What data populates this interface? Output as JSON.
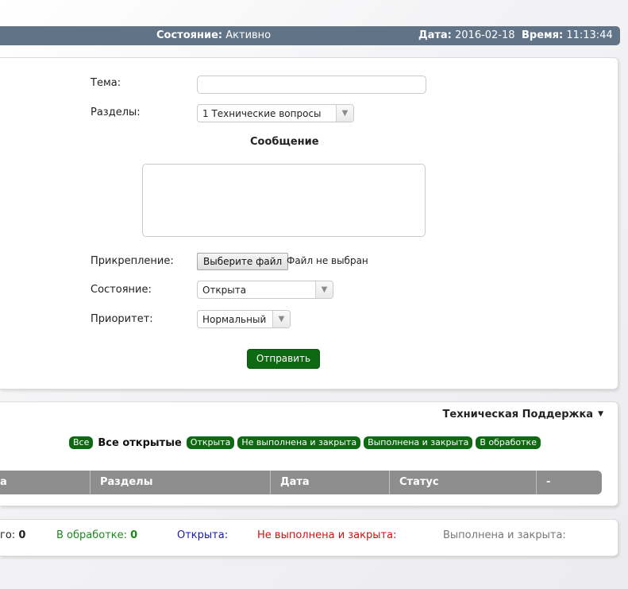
{
  "status_bar": {
    "state_label": "Состояние:",
    "state_value": "Активно",
    "date_label": "Дата:",
    "date_value": "2016-02-18",
    "time_label": "Время:",
    "time_value": "11:13:44"
  },
  "form": {
    "subject_label": "Тема:",
    "subject_value": "",
    "sections_label": "Разделы:",
    "sections_value": "1 Технические вопросы",
    "message_title": "Сообщение",
    "message_value": "",
    "attachment_label": "Прикрепление:",
    "attachment_button": "Выберите файл",
    "attachment_status": "Файл не выбран",
    "state_label": "Состояние:",
    "state_value": "Открыта",
    "priority_label": "Приоритет:",
    "priority_value": "Нормальный",
    "submit_label": "Отправить"
  },
  "support": {
    "title": "Техническая Поддержка",
    "filters": {
      "all": "Все",
      "all_open": "Все открытые",
      "open": "Открыта",
      "not_done_closed": "Не выполнена и закрыта",
      "done_closed": "Выполнена и закрыта",
      "in_progress": "В обработке"
    },
    "columns": [
      "а",
      "Разделы",
      "Дата",
      "Статус",
      "-"
    ]
  },
  "stats": {
    "total_label": "го:",
    "total_value": "0",
    "in_progress_label": "В обработке:",
    "in_progress_value": "0",
    "open_label": "Открыта:",
    "not_done_label": "Не выполнена и закрыта:",
    "done_label": "Выполнена и закрыта:"
  },
  "colors": {
    "status_bar": "#617386",
    "accent_green": "#0d6a12",
    "table_header": "#8d8d8d",
    "stat_green": "#1a8a1a",
    "stat_blue": "#1a1aa8",
    "stat_red": "#d01010",
    "stat_gray": "#777777"
  }
}
